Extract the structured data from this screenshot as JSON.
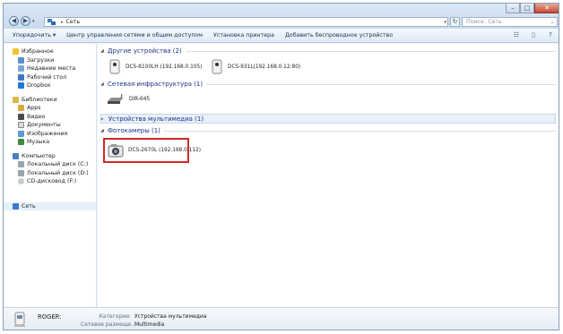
{
  "address": {
    "path": "Сеть"
  },
  "search": {
    "placeholder": "Поиск: Сеть"
  },
  "toolbar": {
    "organize": "Упорядочить ▾",
    "network_center": "Центр управления сетями и общим доступом",
    "printer_setup": "Установка принтера",
    "add_wireless": "Добавить беспроводное устройство"
  },
  "nav": {
    "favorites": {
      "title": "Избранное",
      "items": [
        "Загрузки",
        "Недавние места",
        "Рабочий стол",
        "Dropbox"
      ]
    },
    "libraries": {
      "title": "Библиотеки",
      "items": [
        "Apps",
        "Видео",
        "Документы",
        "Изображения",
        "Музыка"
      ]
    },
    "computer": {
      "title": "Компьютер",
      "items": [
        "Локальный диск (C:)",
        "Локальный диск (D:)",
        "CD-дисковод (F:)"
      ]
    },
    "network": {
      "title": "Сеть"
    }
  },
  "groups": {
    "other": {
      "label": "Другие устройства (2)",
      "devices": [
        "DCS-8100LH (192.168.0.105)",
        "DCS-931L(192.168.0.12:80)"
      ]
    },
    "infrastructure": {
      "label": "Сетевая инфраструктура (1)",
      "devices": [
        "DIR-645"
      ]
    },
    "multimedia": {
      "label": "Устройства мультимедиа (1)"
    },
    "cameras": {
      "label": "Фотокамеры (1)",
      "devices": [
        "DCS-2670L (192.168.0.112)"
      ]
    }
  },
  "details": {
    "name": "ROGER:",
    "category_key": "Категории:",
    "category_val": "Устройства мультимедиа",
    "location_key": "Сетевое размеще...",
    "location_val": "Multimedia"
  },
  "colors": {
    "selection_border": "#cc2a2a",
    "group_heading": "#1e3287"
  }
}
